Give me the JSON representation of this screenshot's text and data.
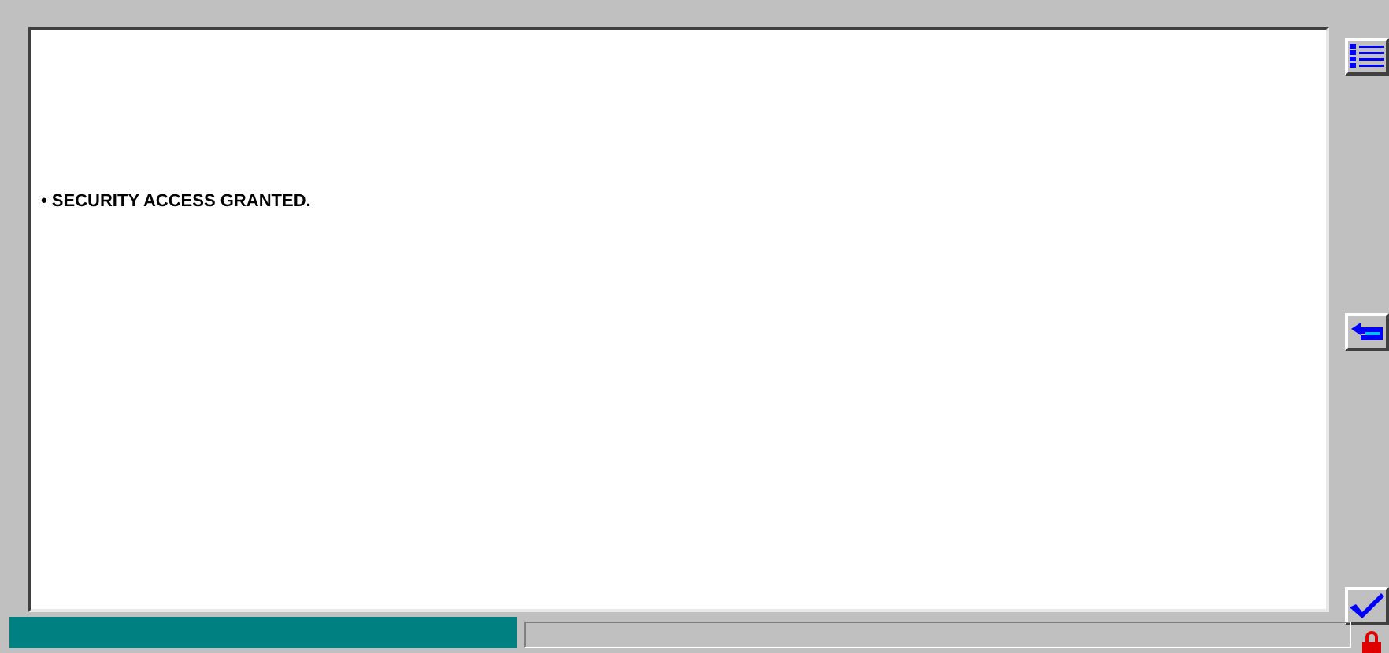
{
  "messages": [
    {
      "text": "• SECURITY ACCESS GRANTED."
    }
  ],
  "side_buttons": [
    {
      "kind": "list"
    },
    {
      "kind": "back"
    },
    {
      "kind": "ok"
    }
  ],
  "status_bar": {
    "locked": true
  }
}
